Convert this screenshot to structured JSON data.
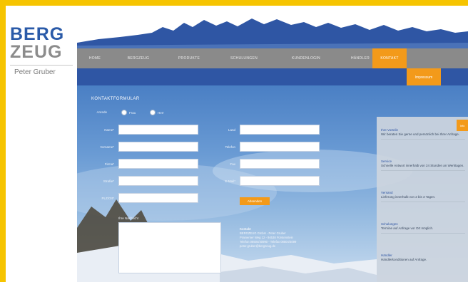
{
  "logo": {
    "line1": "BERG",
    "line2": "ZEUG",
    "name": "Peter Gruber"
  },
  "colors": {
    "frame": "#f6c400",
    "brand_blue": "#2a5aa8",
    "nav_gray": "#8a8a8a",
    "accent_orange": "#f39a1a",
    "subnav_blue": "#2f56a4"
  },
  "nav": {
    "items": [
      {
        "label": "HOME"
      },
      {
        "label": "BERGZEUG"
      },
      {
        "label": "PRODUKTE"
      },
      {
        "label": "SCHULUNGEN"
      },
      {
        "label": "KUNDENLOGIN"
      },
      {
        "label": "HÄNDLER"
      },
      {
        "label": "KONTAKT"
      }
    ],
    "active_index": 6,
    "sub": {
      "label": "Impressum"
    }
  },
  "form": {
    "title": "KONTAKTFORMULAR",
    "salutation_label": "Anrede",
    "radio_options": [
      "Frau",
      "Herr"
    ],
    "left_labels": [
      "Name*",
      "Vorname*",
      "Firma*",
      "Straße*",
      "PLZ/Ort*"
    ],
    "right_labels": [
      "Land",
      "Telefon",
      "Fax",
      "E-Mail*"
    ],
    "submit_label": "Absenden",
    "message_label": "Ihre Nachricht"
  },
  "contact": {
    "title": "Kontakt",
    "lines": [
      "BERGZEUG GmbH - Peter Gruber",
      "Pramerner Weg 12 - 94538 Fürstenstein",
      "Telefon 08504/40990 - Telefax 08504/4099",
      "peter.gruber@bergzeug.de"
    ]
  },
  "side": {
    "tab_label": "Info",
    "faq": [
      {
        "q": "Ihre Vorteile",
        "a": "Wir beraten Sie gerne und persönlich bei Ihrer Anfrage."
      },
      {
        "q": "Service",
        "a": "Schnelle Antwort innerhalb von 24 Stunden an Werktagen."
      },
      {
        "q": "Versand",
        "a": "Lieferung innerhalb von 2 bis 3 Tagen."
      },
      {
        "q": "Schulungen",
        "a": "Termine auf Anfrage vor Ort möglich."
      },
      {
        "q": "Händler",
        "a": "Händlerkonditionen auf Anfrage."
      }
    ]
  }
}
